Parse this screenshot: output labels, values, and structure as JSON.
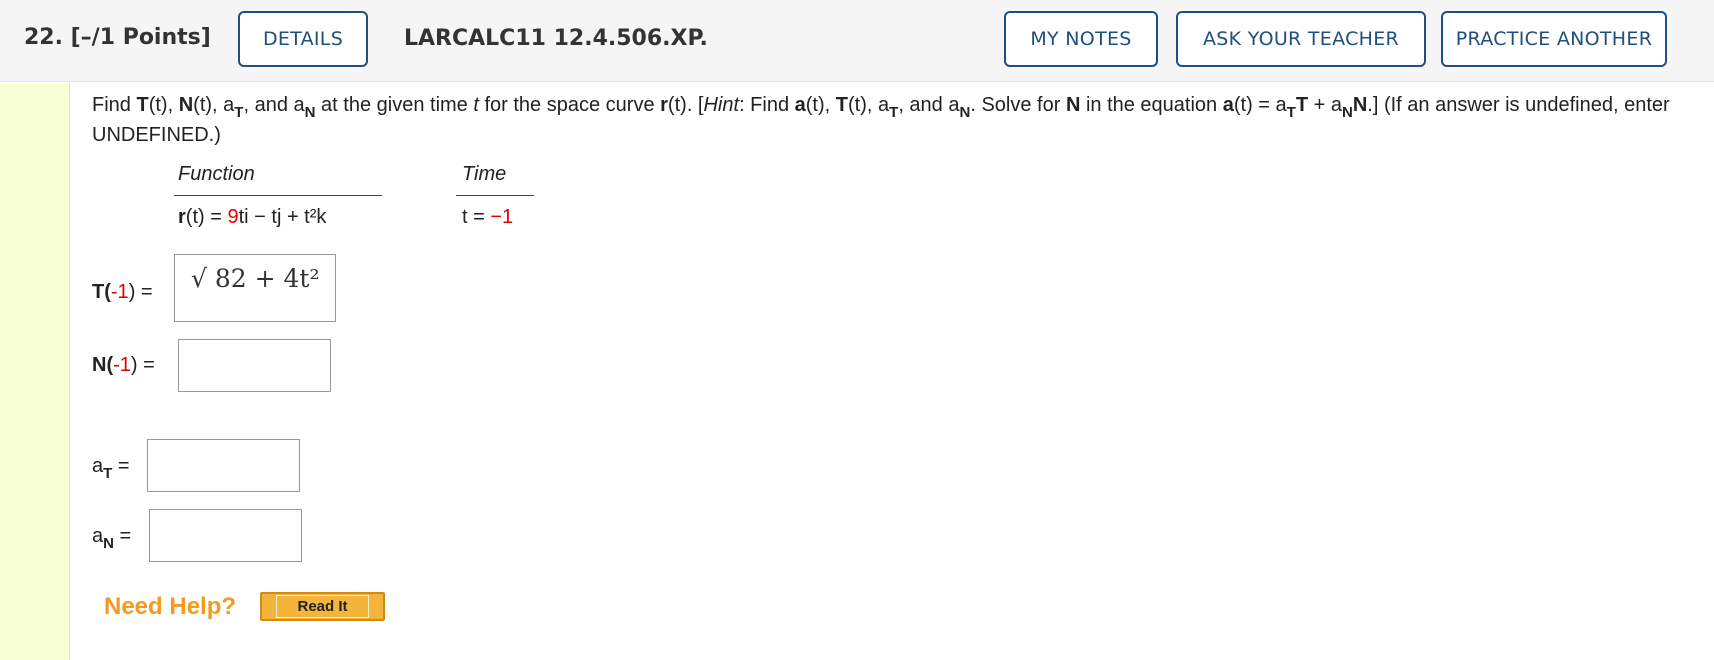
{
  "header": {
    "question_label": "22. [–/1 Points]",
    "details_button": "DETAILS",
    "question_id": "LARCALC11 12.4.506.XP.",
    "my_notes_button": "MY NOTES",
    "ask_teacher_button": "ASK YOUR TEACHER",
    "practice_button": "PRACTICE ANOTHER"
  },
  "prompt": {
    "find": "Find ",
    "T": "T",
    "t_paren": "(t)",
    "comma": ", ",
    "N": "N",
    "aT_a": "a",
    "T_sub": "T",
    "and": ", and ",
    "aN_a": "a",
    "N_sub": "N",
    "rest1": " at the given time ",
    "t": "t",
    "rest2": " for the space curve ",
    "r": "r",
    "rest3": ". [",
    "hint": "Hint",
    "rest4": ": Find ",
    "a": "a",
    "rest5": ". Solve for ",
    "rest6": " in the equation ",
    "eq": " = ",
    "plus": " + ",
    "end": ".] (If an answer is undefined, enter UNDEFINED.)"
  },
  "table": {
    "function_header": "Function",
    "time_header": "Time",
    "func_r": "r",
    "func_pre": "(t) = ",
    "func_coef": "9",
    "func_rest": "ti − tj + t²k",
    "time_pre": "t = ",
    "time_val": "−1"
  },
  "answers": {
    "T_label_main": "T(",
    "T_label_val": "-1",
    "T_label_end": ") =",
    "T_value": "√ 82 + 4t²",
    "N_label_main": "N(",
    "N_label_val": "-1",
    "N_label_end": ") =",
    "aT_label": "a",
    "aT_sub": "T",
    "aT_eq": " =",
    "aN_label": "a",
    "aN_sub": "N",
    "aN_eq": " ="
  },
  "help": {
    "need_help": "Need Help?",
    "read_it": "Read It"
  },
  "colors": {
    "accent": "#1f4f7d",
    "highlight_red": "#e00000",
    "help_orange": "#f39a1f",
    "sidebar": "#f9ffd5"
  }
}
